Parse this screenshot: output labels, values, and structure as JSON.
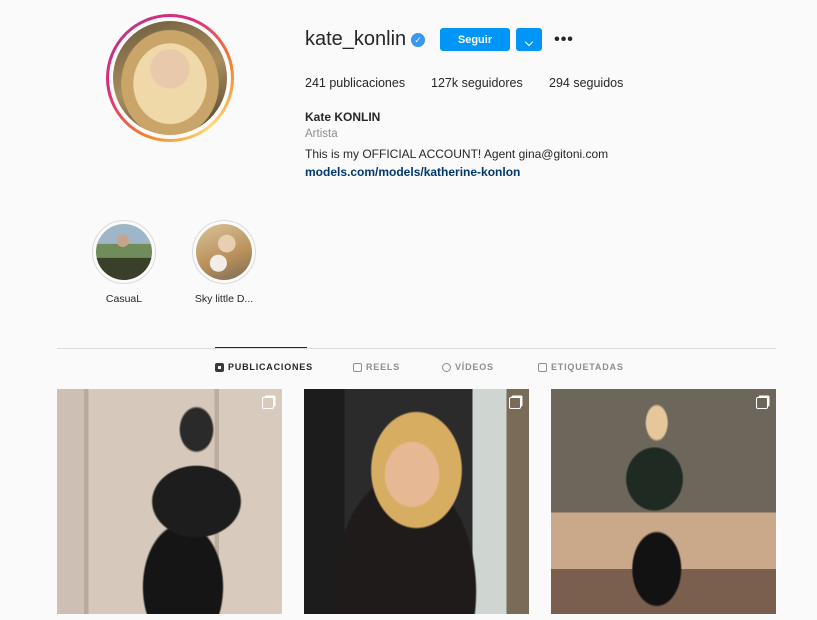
{
  "profile": {
    "username": "kate_konlin",
    "follow_label": "Seguir",
    "more_label": "•••",
    "stats": {
      "posts": "241 publicaciones",
      "followers": "127k seguidores",
      "following": "294 seguidos"
    },
    "full_name": "Kate KONLIN",
    "category": "Artista",
    "bio": "This is my OFFICIAL ACCOUNT! Agent gina@gitoni.com",
    "link": "models.com/models/katherine-konlon"
  },
  "highlights": [
    {
      "label": "CasuaL"
    },
    {
      "label": "Sky little D..."
    }
  ],
  "tabs": [
    {
      "label": "PUBLICACIONES",
      "icon": "grid-icon",
      "active": true
    },
    {
      "label": "REELS",
      "icon": "reels-icon",
      "active": false
    },
    {
      "label": "VÍDEOS",
      "icon": "video-icon",
      "active": false
    },
    {
      "label": "ETIQUETADAS",
      "icon": "tagged-icon",
      "active": false
    }
  ],
  "colors": {
    "accent": "#0095f6",
    "verified": "#3897f0",
    "link": "#00376b",
    "muted": "#8e8e8e"
  }
}
